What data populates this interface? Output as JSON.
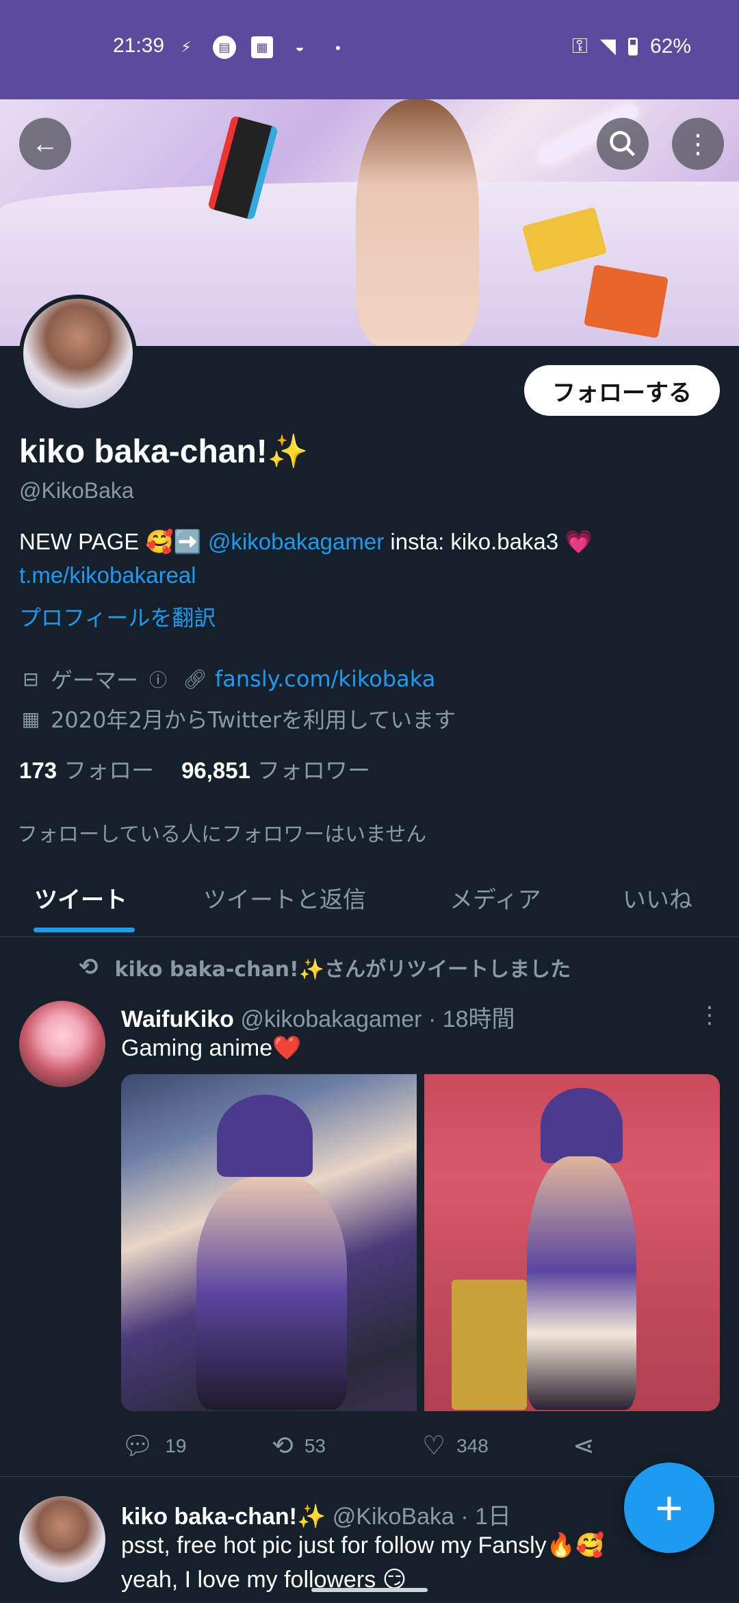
{
  "status_bar": {
    "time": "21:39",
    "battery": "62%",
    "background": "#5b4a9e"
  },
  "profile": {
    "display_name": "kiko baka-chan!✨",
    "handle": "@KikoBaka",
    "bio_prefix": "NEW PAGE 🥰➡️ ",
    "bio_mention": "@kikobakagamer",
    "bio_middle": " insta: kiko.baka3 💗 ",
    "bio_link": "t.me/kikobakareal",
    "translate": "プロフィールを翻訳",
    "category": "ゲーマー",
    "website": "fansly.com/kikobaka",
    "joined": "2020年2月からTwitterを利用しています",
    "following_count": "173",
    "following_label": "フォロー",
    "followers_count": "96,851",
    "followers_label": "フォロワー",
    "no_followers_you_know": "フォローしている人にフォロワーはいません",
    "follow_button": "フォローする"
  },
  "tabs": [
    {
      "label": "ツイート",
      "active": true
    },
    {
      "label": "ツイートと返信",
      "active": false
    },
    {
      "label": "メディア",
      "active": false
    },
    {
      "label": "いいね",
      "active": false
    }
  ],
  "tweets": [
    {
      "retweet_notice": "kiko baka-chan!✨さんがリツイートしました",
      "name": "WaifuKiko",
      "handle": "@kikobakagamer",
      "time": "· 18時間",
      "text": "Gaming anime❤️",
      "replies": "19",
      "retweets": "53",
      "likes": "348"
    },
    {
      "name": "kiko baka-chan!✨",
      "handle": "@KikoBaka",
      "time": "· 1日",
      "text": "psst, free hot pic just for follow my Fansly🔥🥰",
      "text2": "yeah, I love my followers 😏"
    }
  ],
  "icons": {
    "back": "arrow-left-icon",
    "search": "search-icon",
    "more": "more-vertical-icon",
    "compose": "plus-icon"
  },
  "colors": {
    "accent": "#1d9bf0",
    "background": "#15202b",
    "muted": "#8b98a5"
  }
}
